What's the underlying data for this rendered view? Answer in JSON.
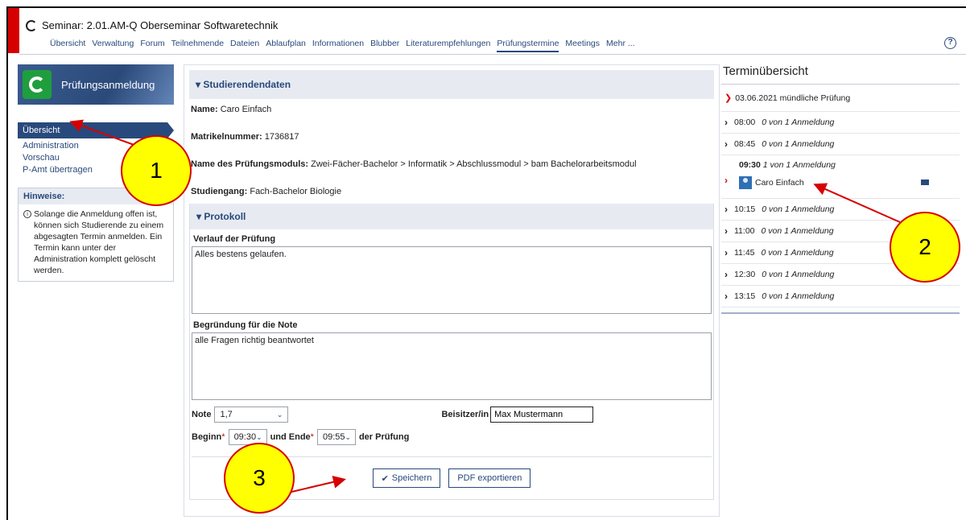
{
  "header": {
    "course_title": "Seminar: 2.01.AM-Q Oberseminar Softwaretechnik",
    "nav": [
      "Übersicht",
      "Verwaltung",
      "Forum",
      "Teilnehmende",
      "Dateien",
      "Ablaufplan",
      "Informationen",
      "Blubber",
      "Literaturempfehlungen",
      "Prüfungstermine",
      "Meetings",
      "Mehr ..."
    ],
    "active_nav": "Prüfungstermine",
    "help_symbol": "?"
  },
  "sidebar": {
    "title": "Prüfungsanmeldung",
    "items": [
      "Übersicht",
      "Administration",
      "Vorschau",
      "P-Amt übertragen"
    ],
    "active_item": "Übersicht",
    "hints_title": "Hinweise:",
    "hints_text": "Solange die Anmeldung offen ist, können sich Studierende zu einem abgesagten Termin anmelden. Ein Termin kann unter der Administration komplett gelöscht werden."
  },
  "student": {
    "section_title": "Studierendendaten",
    "name_label": "Name:",
    "name": "Caro Einfach",
    "matrikel_label": "Matrikelnummer:",
    "matrikel": "1736817",
    "module_label": "Name des Prüfungsmoduls:",
    "module": "Zwei-Fächer-Bachelor > Informatik > Abschlussmodul > bam Bachelorarbeitsmodul",
    "program_label": "Studiengang:",
    "program": "Fach-Bachelor Biologie"
  },
  "protocol": {
    "section_title": "Protokoll",
    "verlauf_label": "Verlauf der Prüfung",
    "verlauf_value": "Alles bestens gelaufen.",
    "begruendung_label": "Begründung für die Note",
    "begruendung_value": "alle Fragen richtig beantwortet",
    "note_label": "Note",
    "note_value": "1,7",
    "beisitzer_label": "Beisitzer/in",
    "beisitzer_value": "Max Mustermann",
    "beginn_label": "Beginn",
    "beginn_value": "09:30",
    "ende_label": "und Ende",
    "ende_value": "09:55",
    "suffix": "der Prüfung",
    "save_label": "Speichern",
    "pdf_label": "PDF exportieren"
  },
  "overview": {
    "title": "Terminübersicht",
    "date": "03.06.2021 mündliche Prüfung",
    "slots": [
      {
        "time": "08:00",
        "info": "0 von 1 Anmeldung"
      },
      {
        "time": "08:45",
        "info": "0 von 1 Anmeldung"
      },
      {
        "time": "09:30",
        "info": "1 von 1 Anmeldung"
      },
      {
        "time": "10:15",
        "info": "0 von 1 Anmeldung"
      },
      {
        "time": "11:00",
        "info": "0 von 1 Anmeldung"
      },
      {
        "time": "11:45",
        "info": "0 von 1 Anmeldung"
      },
      {
        "time": "12:30",
        "info": "0 von 1 Anmeldung"
      },
      {
        "time": "13:15",
        "info": "0 von 1 Anmeldung"
      }
    ],
    "booked_person": "Caro Einfach"
  },
  "callouts": [
    "1",
    "2",
    "3"
  ],
  "colors": {
    "accent": "#28497c",
    "brand_red": "#d60000",
    "callout": "#ffff00"
  }
}
